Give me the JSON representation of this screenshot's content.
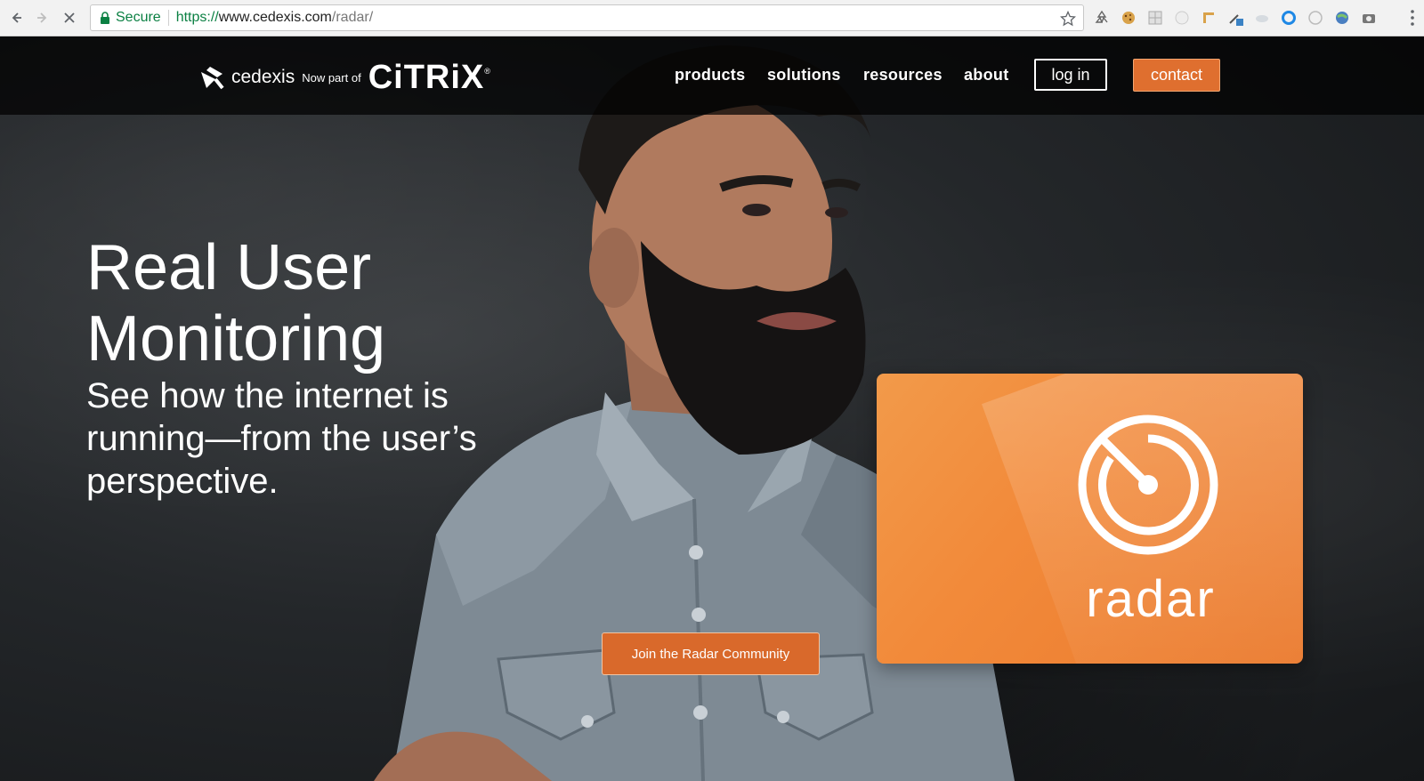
{
  "browser": {
    "secure_label": "Secure",
    "url_scheme": "https://",
    "url_host": "www.cedexis.com",
    "url_path": "/radar/"
  },
  "header": {
    "logo_cedexis": "cedexis",
    "logo_now_part_of": "Now part of",
    "logo_citrix": "CiTRiX",
    "logo_registered": "®",
    "nav": {
      "products": "products",
      "solutions": "solutions",
      "resources": "resources",
      "about": "about"
    },
    "login_label": "log in",
    "contact_label": "contact"
  },
  "hero": {
    "title_line1": "Real User",
    "title_line2": "Monitoring",
    "subtitle": "See how the internet is running—from the user’s perspective.",
    "cta_label": "Join the Radar Community"
  },
  "radar_card": {
    "word": "radar"
  },
  "colors": {
    "accent_orange": "#df6f2f",
    "card_orange": "#f28a3a",
    "secure_green": "#0b8043"
  }
}
